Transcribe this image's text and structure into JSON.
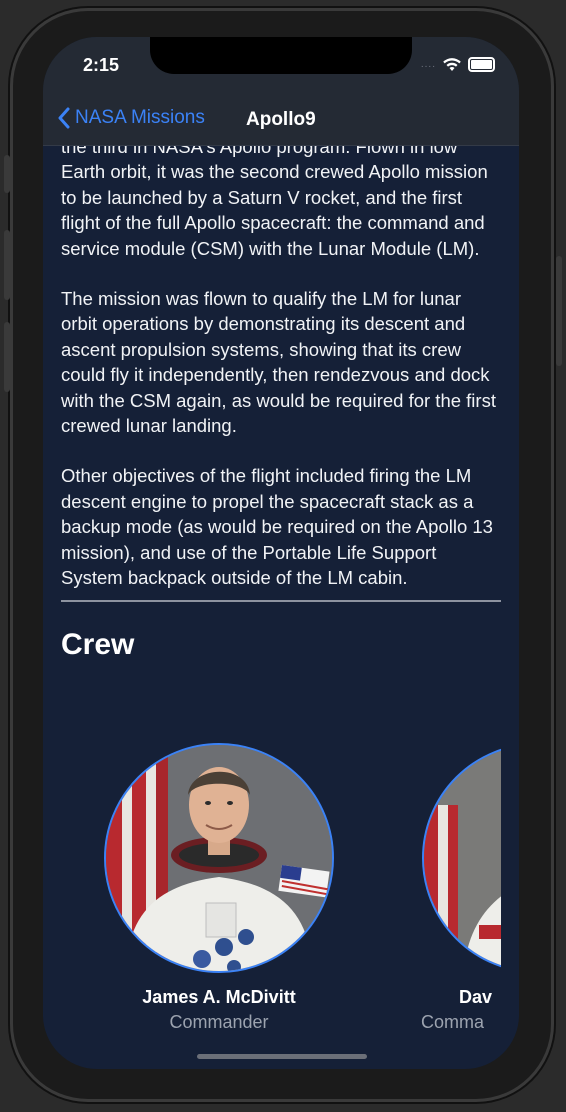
{
  "status": {
    "time": "2:15",
    "signal": "....",
    "icons": [
      "wifi-icon",
      "battery-icon"
    ]
  },
  "nav": {
    "back_label": "NASA Missions",
    "title": "Apollo9"
  },
  "description": {
    "p1": "the third in NASA's Apollo program. Flown in low Earth orbit, it was the second crewed Apollo mission to be launched by a Saturn V rocket, and the first flight of the full Apollo spacecraft: the command and service module (CSM) with the Lunar Module (LM).",
    "p2": "The mission was flown to qualify the LM for lunar orbit operations by demonstrating its descent and ascent propulsion systems, showing that its crew could fly it independently, then rendezvous and dock with the CSM again, as would be required for the first crewed lunar landing.",
    "p3": "Other objectives of the flight included firing the LM descent engine to propel the spacecraft stack as a backup mode (as would be required on the Apollo 13 mission), and use of the Portable Life Support System backpack outside of the LM cabin."
  },
  "crew": {
    "heading": "Crew",
    "members": [
      {
        "name": "James A. McDivitt",
        "role": "Commander"
      },
      {
        "name": "Dav",
        "role": "Comma"
      }
    ]
  },
  "colors": {
    "accent": "#3b82f6",
    "background": "#152037",
    "bar": "#242a34"
  }
}
